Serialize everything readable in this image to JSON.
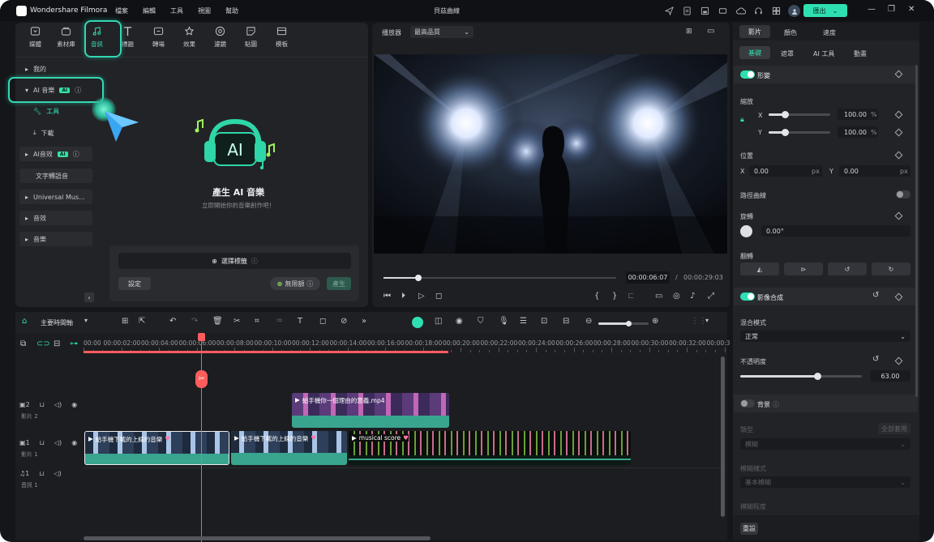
{
  "app": {
    "name": "Wondershare Filmora",
    "doc_title": "貝茲曲線",
    "export_label": "匯出"
  },
  "menu": [
    "檔案",
    "編輯",
    "工具",
    "視圖",
    "幫助"
  ],
  "media_tabs": [
    {
      "label": "媒體",
      "icon": "media-icon"
    },
    {
      "label": "素材庫",
      "icon": "stock-icon"
    },
    {
      "label": "音訊",
      "icon": "audio-icon",
      "active": true
    },
    {
      "label": "標題",
      "icon": "title-icon"
    },
    {
      "label": "轉場",
      "icon": "transition-icon"
    },
    {
      "label": "效果",
      "icon": "effects-icon"
    },
    {
      "label": "濾鏡",
      "icon": "filter-icon"
    },
    {
      "label": "貼圖",
      "icon": "sticker-icon"
    },
    {
      "label": "模板",
      "icon": "template-icon"
    }
  ],
  "sidebar": {
    "mine": "我的",
    "ai_music": "AI 音樂",
    "ai_badge": "AI",
    "tools": "工具",
    "download": "下載",
    "ai_sfx": "AI音效",
    "ai_sfx_badge": "AI",
    "tts": "文字轉語音",
    "universal": "Universal Mus...",
    "sfx": "音效",
    "music": "音樂"
  },
  "ai_music_panel": {
    "title": "產生 AI 音樂",
    "subtitle": "立即開始你的音樂創作吧！",
    "select_label": "選擇標籤",
    "settings": "設定",
    "unlimited": "無限額",
    "generate": "產生"
  },
  "player": {
    "label": "播放器",
    "quality": "最高品質",
    "current_time": "00:00:06:07",
    "separator": "/",
    "total_time": "00:00:29:03",
    "progress": 0.15
  },
  "timeline": {
    "main_track": "主要時間軸",
    "ruler": [
      "00:00",
      "00:00:02:00",
      "00:00:04:00",
      "00:00:06:00",
      "00:00:08:00",
      "00:00:10:00",
      "00:00:12:00",
      "00:00:14:00",
      "00:00:16:00",
      "00:00:18:00",
      "00:00:20:00",
      "00:00:22:00",
      "00:00:24:00",
      "00:00:26:00",
      "00:00:28:00",
      "00:00:30:00",
      "00:00:32:00",
      "00:00:3"
    ],
    "tracks": [
      {
        "num": "2",
        "label": "影片 2"
      },
      {
        "num": "1",
        "label": "影片 1"
      },
      {
        "num": "1",
        "label": "音訊 1"
      }
    ],
    "clips": {
      "v2": "給手機你一個理由的意義.mp4",
      "v1a": "給手機下載的上線的音樂",
      "v1b": "給手機下載的上線的音樂",
      "v1c": "musical score"
    },
    "zoom": 0.6
  },
  "inspector": {
    "tabs": [
      "影片",
      "顏色",
      "速度"
    ],
    "subtabs": [
      "基礎",
      "遮罩",
      "AI 工具",
      "動畫"
    ],
    "transform": "形變",
    "scale": "縮放",
    "x": "X",
    "y": "Y",
    "scale_x": "100.00",
    "scale_y": "100.00",
    "percent": "%",
    "position": "位置",
    "pos_x": "0.00",
    "pos_y": "0.00",
    "px": "px",
    "path_curve": "路徑曲線",
    "rotate": "旋轉",
    "rotate_val": "0.00°",
    "flip": "翻轉",
    "compositing": "影像合成",
    "blend_mode": "混合模式",
    "blend_val": "正常",
    "opacity": "不透明度",
    "opacity_val": "63.00",
    "opacity_frac": 0.63,
    "background": "背景",
    "bg_type": "類型",
    "bg_apply_all": "全部套用",
    "bg_type_val": "模糊",
    "blur_style": "模糊樣式",
    "blur_style_val": "基本模糊",
    "blur_amount": "模糊程度",
    "reset": "重設"
  },
  "colors": {
    "accent": "#2ee0b1",
    "playhead": "#ff5c5c",
    "clip_teal": "#3aa58f"
  }
}
